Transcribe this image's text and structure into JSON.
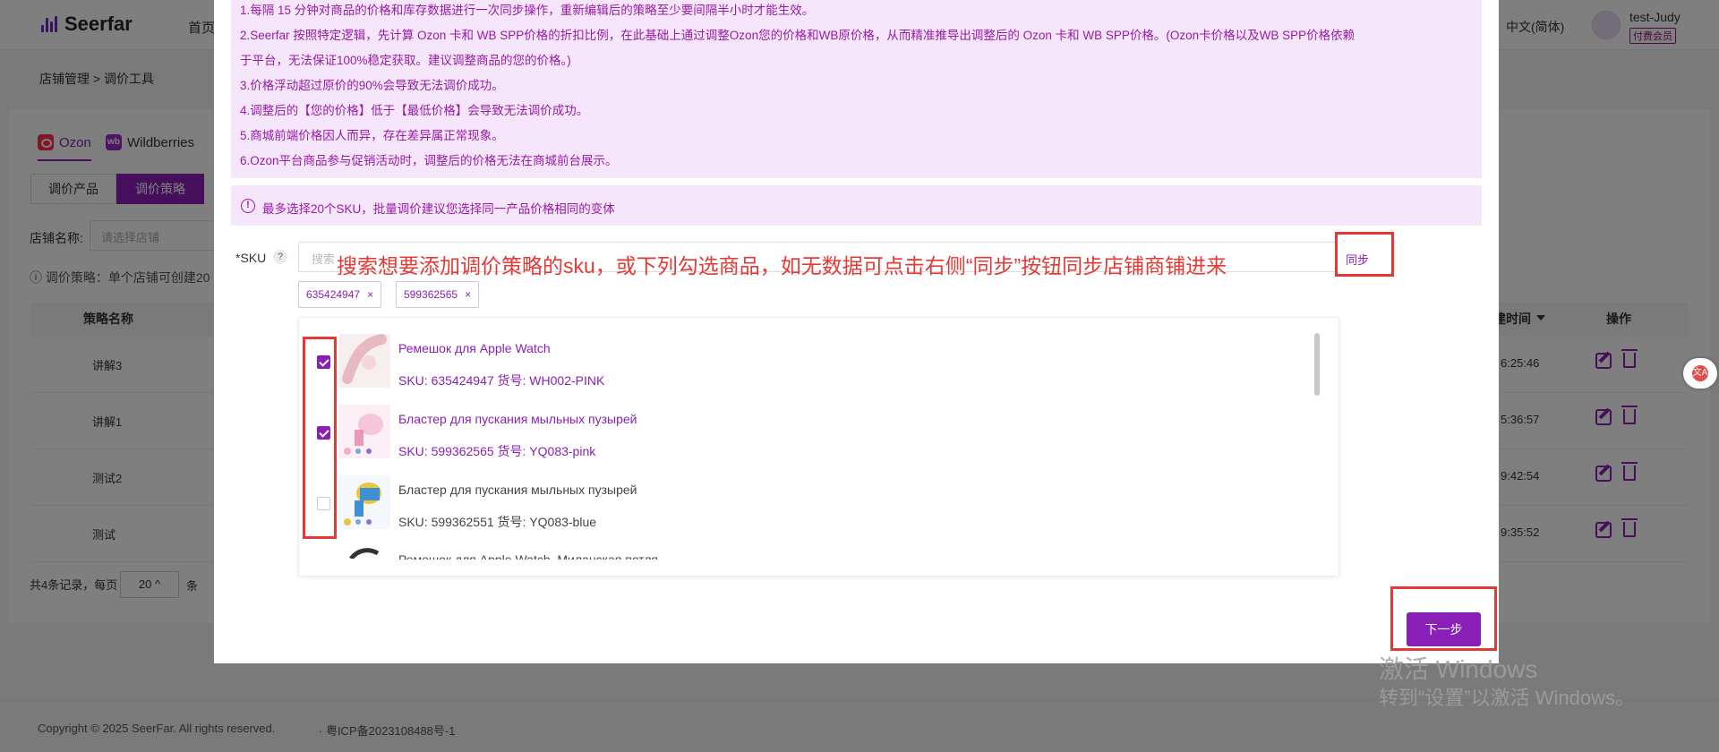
{
  "app": {
    "logo_text": "Seerfar",
    "nav_home": "首页",
    "language": "中文(简体)",
    "user_name": "test-Judy",
    "member_badge": "付费会员"
  },
  "breadcrumb": {
    "text": "店铺管理 > 调价工具"
  },
  "platforms": {
    "ozon": "Ozon",
    "wb": "Wildberries",
    "wb_icon_text": "wb"
  },
  "tabs": {
    "products": "调价产品",
    "strategy": "调价策略"
  },
  "filters": {
    "store_label": "店铺名称:",
    "store_placeholder": "请选择店铺"
  },
  "strategy_note": "调价策略：单个店铺可创建20",
  "table": {
    "col_name": "策略名称",
    "col_time": "建时间",
    "col_ops": "操作",
    "rows": [
      {
        "name": "讲解3",
        "time": "6:25:46"
      },
      {
        "name": "讲解1",
        "time": "5:36:57"
      },
      {
        "name": "测试2",
        "time": "9:42:54"
      },
      {
        "name": "测试",
        "time": "9:35:52"
      }
    ]
  },
  "pagination": {
    "total_text": "共4条记录，每页",
    "page_size": "20 ^",
    "unit": "条"
  },
  "footer": {
    "copyright": "Copyright © 2025 SeerFar. All rights reserved.",
    "icp": "·   粤ICP备2023108488号-1"
  },
  "modal": {
    "rules": [
      "1.每隔 15 分钟对商品的价格和库存数据进行一次同步操作，重新编辑后的策略至少要间隔半小时才能生效。",
      "2.Seerfar 按照特定逻辑，先计算 Ozon 卡和 WB SPP价格的折扣比例，在此基础上通过调整Ozon您的价格和WB原价格，从而精准推导出调整后的 Ozon 卡和 WB SPP价格。(Ozon卡价格以及WB SPP价格依赖",
      "于平台，无法保证100%稳定获取。建议调整商品的您的价格。)",
      "3.价格浮动超过原价的90%会导致无法调价成功。",
      "4.调整后的【您的价格】低于【最低价格】会导致无法调价成功。",
      "5.商城前端价格因人而异，存在差异属正常现象。",
      "6.Ozon平台商品参与促销活动时，调整后的价格无法在商城前台展示。"
    ],
    "limit_icon": "!",
    "limit_text": "最多选择20个SKU，批量调价建议您选择同一产品价格相同的变体",
    "sku_label": "*SKU",
    "sku_help": "?",
    "sku_placeholder": "搜索",
    "annotation_text": "搜索想要添加调价策略的sku，或下列勾选商品，如无数据可点击右侧“同步”按钮同步店铺商铺进来",
    "sync_label": "同步",
    "tags": [
      {
        "label": "635424947",
        "close": "×"
      },
      {
        "label": "599362565",
        "close": "×"
      }
    ],
    "products": [
      {
        "name": "Ремешок для Apple Watch",
        "meta": "SKU: 635424947   货号: WH002-PINK",
        "checked": true
      },
      {
        "name": "Бластер для пускания мыльных пузырей",
        "meta": "SKU: 599362565   货号: YQ083-pink",
        "checked": true
      },
      {
        "name": "Бластер для пускания мыльных пузырей",
        "meta": "SKU: 599362551   货号: YQ083-blue",
        "checked": false
      },
      {
        "name": "Ремешок для Apple Watch, Миланская петля",
        "meta": "",
        "checked": false
      }
    ],
    "next_label": "下一步"
  },
  "watermark": {
    "line1": "激活 Windows",
    "line2": "转到“设置”以激活 Windows。"
  },
  "colors": {
    "accent": "#8a1fb8",
    "annotation": "#e53935",
    "info_bg": "#f6e6fb"
  }
}
